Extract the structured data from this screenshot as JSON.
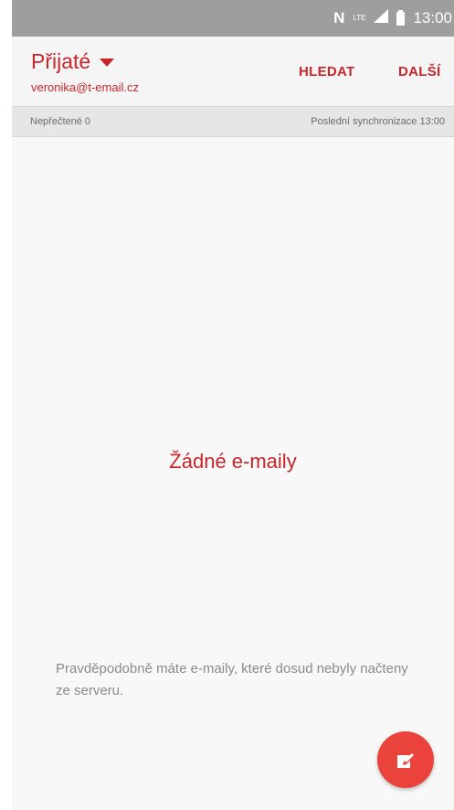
{
  "status_bar": {
    "nfc_icon": "nfc-icon",
    "network_label": "LTE",
    "time": "13:00"
  },
  "header": {
    "folder_title": "Přijaté",
    "account_email": "veronika@t-email.cz",
    "search_label": "HLEDAT",
    "more_label": "DALŠÍ"
  },
  "info_bar": {
    "unread_text": "Nepřečtené 0",
    "last_sync_text": "Poslední synchronizace 13:00"
  },
  "content": {
    "empty_title": "Žádné e-maily",
    "hint_text": "Pravděpodobně máte e-maily, které dosud nebyly načteny ze serveru."
  },
  "fab": {
    "icon": "compose-icon"
  },
  "colors": {
    "accent": "#c8262a",
    "fab": "#e9433b",
    "status_bar": "#9e9e9e"
  }
}
